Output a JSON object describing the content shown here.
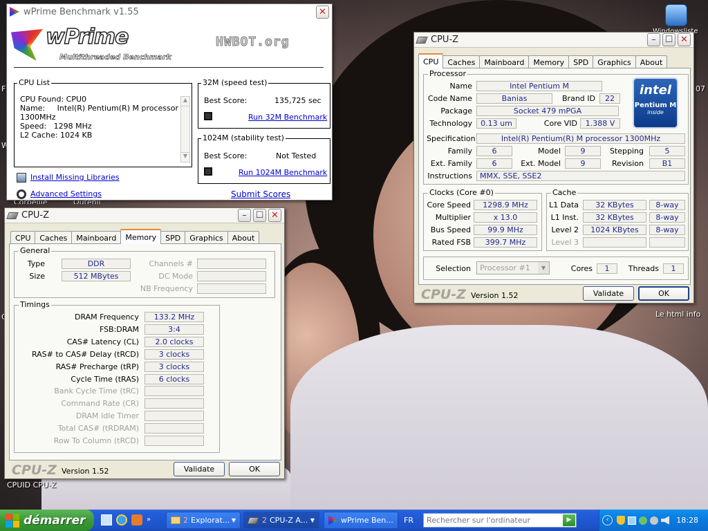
{
  "desktop": {
    "label_left": "CPUID CPU-Z",
    "label_right": "Le html info",
    "frag_corbeille": "Corbeille",
    "frag_outenil": "Outenil",
    "frag_top_right": "Windowsliste",
    "frag_07": "07",
    "frag_f": "F",
    "frag_w": "W",
    "frag_c": "C"
  },
  "wprime": {
    "title": "wPrime Benchmark v1.55",
    "logo_main": "wPrime",
    "logo_sub": "Multithreaded Benchmark",
    "hwbot": "HWBOT.org",
    "cpu_list_label": "CPU List",
    "cpu_list_lines": [
      "CPU Found: CPU0",
      "Name:     Intel(R) Pentium(R) M processor",
      "1300MHz",
      "Speed:   1298 MHz",
      "L2 Cache: 1024 KB"
    ],
    "g32_label": "32M (speed test)",
    "g32_best_label": "Best Score:",
    "g32_best_value": "135,725 sec",
    "g32_run": "Run 32M Benchmark",
    "g1024_label": "1024M (stability test)",
    "g1024_best_label": "Best Score:",
    "g1024_best_value": "Not Tested",
    "g1024_run": "Run 1024M Benchmark",
    "install_libs": "Install Missing Libraries",
    "advanced": "Advanced Settings",
    "submit": "Submit Scores"
  },
  "cpuz_cpu": {
    "title": "CPU-Z",
    "tabs": [
      "CPU",
      "Caches",
      "Mainboard",
      "Memory",
      "SPD",
      "Graphics",
      "About"
    ],
    "active_tab": "CPU",
    "processor_label": "Processor",
    "name_label": "Name",
    "name": "Intel Pentium M",
    "codename_label": "Code Name",
    "codename": "Banias",
    "brandid_label": "Brand ID",
    "brandid": "22",
    "package_label": "Package",
    "package": "Socket 479 mPGA",
    "technology_label": "Technology",
    "technology": "0.13 um",
    "corevid_label": "Core VID",
    "corevid": "1.388 V",
    "spec_label": "Specification",
    "spec": "Intel(R) Pentium(R) M processor 1300MHz",
    "family_label": "Family",
    "family": "6",
    "model_label": "Model",
    "model": "9",
    "stepping_label": "Stepping",
    "stepping": "5",
    "extfamily_label": "Ext. Family",
    "extfamily": "6",
    "extmodel_label": "Ext. Model",
    "extmodel": "9",
    "revision_label": "Revision",
    "revision": "B1",
    "instructions_label": "Instructions",
    "instructions": "MMX, SSE, SSE2",
    "intel_logo": "intel",
    "intel_brand": "Pentium M",
    "intel_inside": "inside",
    "clocks_label": "Clocks (Core #0)",
    "corespeed_label": "Core Speed",
    "corespeed": "1298.9 MHz",
    "multiplier_label": "Multiplier",
    "multiplier": "x 13.0",
    "busspeed_label": "Bus Speed",
    "busspeed": "99.9 MHz",
    "ratedfsb_label": "Rated FSB",
    "ratedfsb": "399.7 MHz",
    "cache_label": "Cache",
    "l1data_label": "L1 Data",
    "l1data": "32 KBytes",
    "l1data_way": "8-way",
    "l1inst_label": "L1 Inst.",
    "l1inst": "32 KBytes",
    "l1inst_way": "8-way",
    "level2_label": "Level 2",
    "level2": "1024 KBytes",
    "level2_way": "8-way",
    "level3_label": "Level 3",
    "selection_label": "Selection",
    "selection": "Processor #1",
    "cores_label": "Cores",
    "cores": "1",
    "threads_label": "Threads",
    "threads": "1",
    "logo": "CPU-Z",
    "version": "Version 1.52",
    "validate": "Validate",
    "ok": "OK"
  },
  "cpuz_mem": {
    "title": "CPU-Z",
    "tabs": [
      "CPU",
      "Caches",
      "Mainboard",
      "Memory",
      "SPD",
      "Graphics",
      "About"
    ],
    "active_tab": "Memory",
    "general_label": "General",
    "type_label": "Type",
    "type": "DDR",
    "size_label": "Size",
    "size": "512 MBytes",
    "channels_label": "Channels #",
    "dcmode_label": "DC Mode",
    "nbfreq_label": "NB Frequency",
    "timings_label": "Timings",
    "timings": [
      {
        "label": "DRAM Frequency",
        "value": "133.2 MHz"
      },
      {
        "label": "FSB:DRAM",
        "value": "3:4"
      },
      {
        "label": "CAS# Latency (CL)",
        "value": "2.0 clocks"
      },
      {
        "label": "RAS# to CAS# Delay (tRCD)",
        "value": "3 clocks"
      },
      {
        "label": "RAS# Precharge (tRP)",
        "value": "3 clocks"
      },
      {
        "label": "Cycle Time (tRAS)",
        "value": "6 clocks"
      }
    ],
    "timings_dim": [
      "Bank Cycle Time (tRC)",
      "Command Rate (CR)",
      "DRAM Idle Timer",
      "Total CAS# (tRDRAM)",
      "Row To Column (tRCD)"
    ],
    "logo": "CPU-Z",
    "version": "Version 1.52",
    "validate": "Validate",
    "ok": "OK"
  },
  "taskbar": {
    "start": "démarrer",
    "tasks": [
      {
        "count": "2",
        "label": "Explorat..."
      },
      {
        "count": "2",
        "label": "CPU-Z A..."
      },
      {
        "count": "",
        "label": "wPrime Ben..."
      }
    ],
    "lang": "FR",
    "search_placeholder": "Rechercher sur l'ordinateur",
    "clock": "18:28"
  },
  "colors": {
    "value_text": "#1f2a8c",
    "accent_tab": "#e68b2c",
    "taskbar": "#245edc",
    "start": "#3a9a35"
  }
}
